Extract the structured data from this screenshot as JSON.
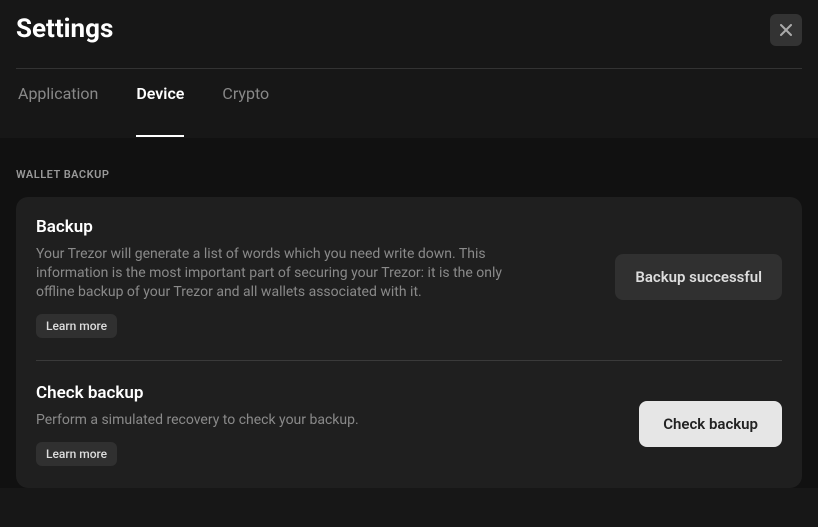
{
  "page_title": "Settings",
  "tabs": [
    {
      "label": "Application",
      "active": false
    },
    {
      "label": "Device",
      "active": true
    },
    {
      "label": "Crypto",
      "active": false
    }
  ],
  "section_label": "WALLET BACKUP",
  "backup": {
    "title": "Backup",
    "desc": "Your Trezor will generate a list of words which you need write down. This information is the most important part of securing your Trezor: it is the only offline backup of your Trezor and all wallets associated with it.",
    "learn_more": "Learn more",
    "status_label": "Backup successful"
  },
  "check_backup": {
    "title": "Check backup",
    "desc": "Perform a simulated recovery to check your backup.",
    "learn_more": "Learn more",
    "button_label": "Check backup"
  }
}
